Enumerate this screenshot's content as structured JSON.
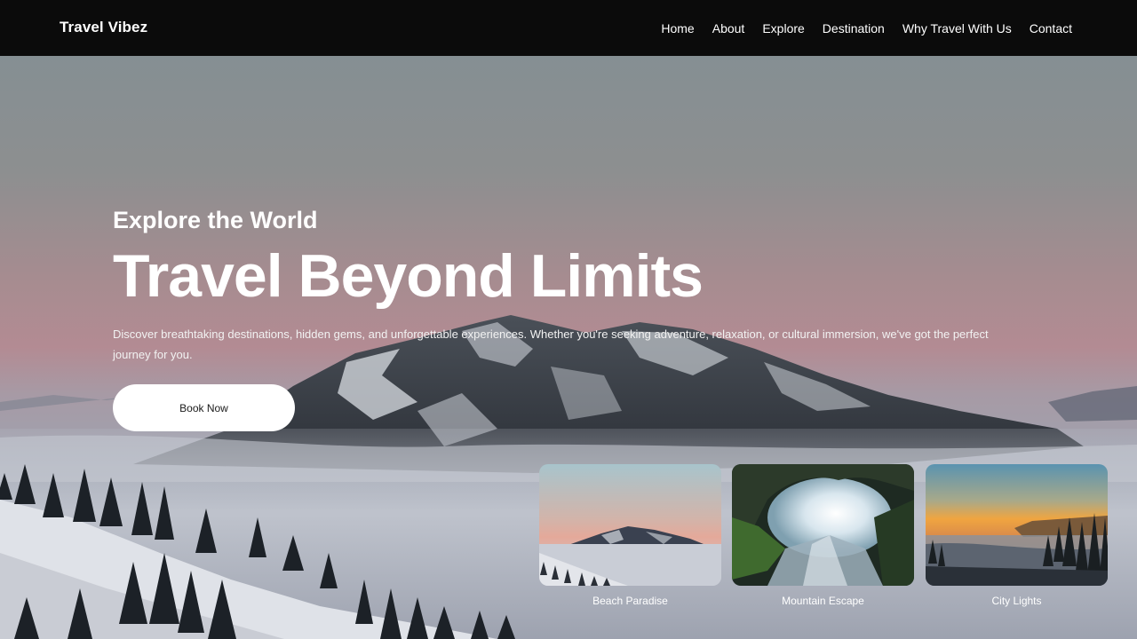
{
  "nav": {
    "brand": "Travel Vibez",
    "links": [
      "Home",
      "About",
      "Explore",
      "Destination",
      "Why Travel With Us",
      "Contact"
    ]
  },
  "hero": {
    "kicker": "Explore the World",
    "title": "Travel Beyond Limits",
    "description": "Discover breathtaking destinations, hidden gems, and unforgettable experiences. Whether you're seeking adventure, relaxation, or cultural immersion, we've got the perfect journey for you.",
    "button_label": "Book Now"
  },
  "cards": [
    {
      "label": "Beach Paradise"
    },
    {
      "label": "Mountain Escape"
    },
    {
      "label": "City Lights"
    }
  ],
  "colors": {
    "nav_bg": "#0b0b0b",
    "sky_top": "#8a9296",
    "sky_pink": "#b48c93",
    "fog": "#c8cdd6",
    "button_bg": "#ffffff"
  }
}
